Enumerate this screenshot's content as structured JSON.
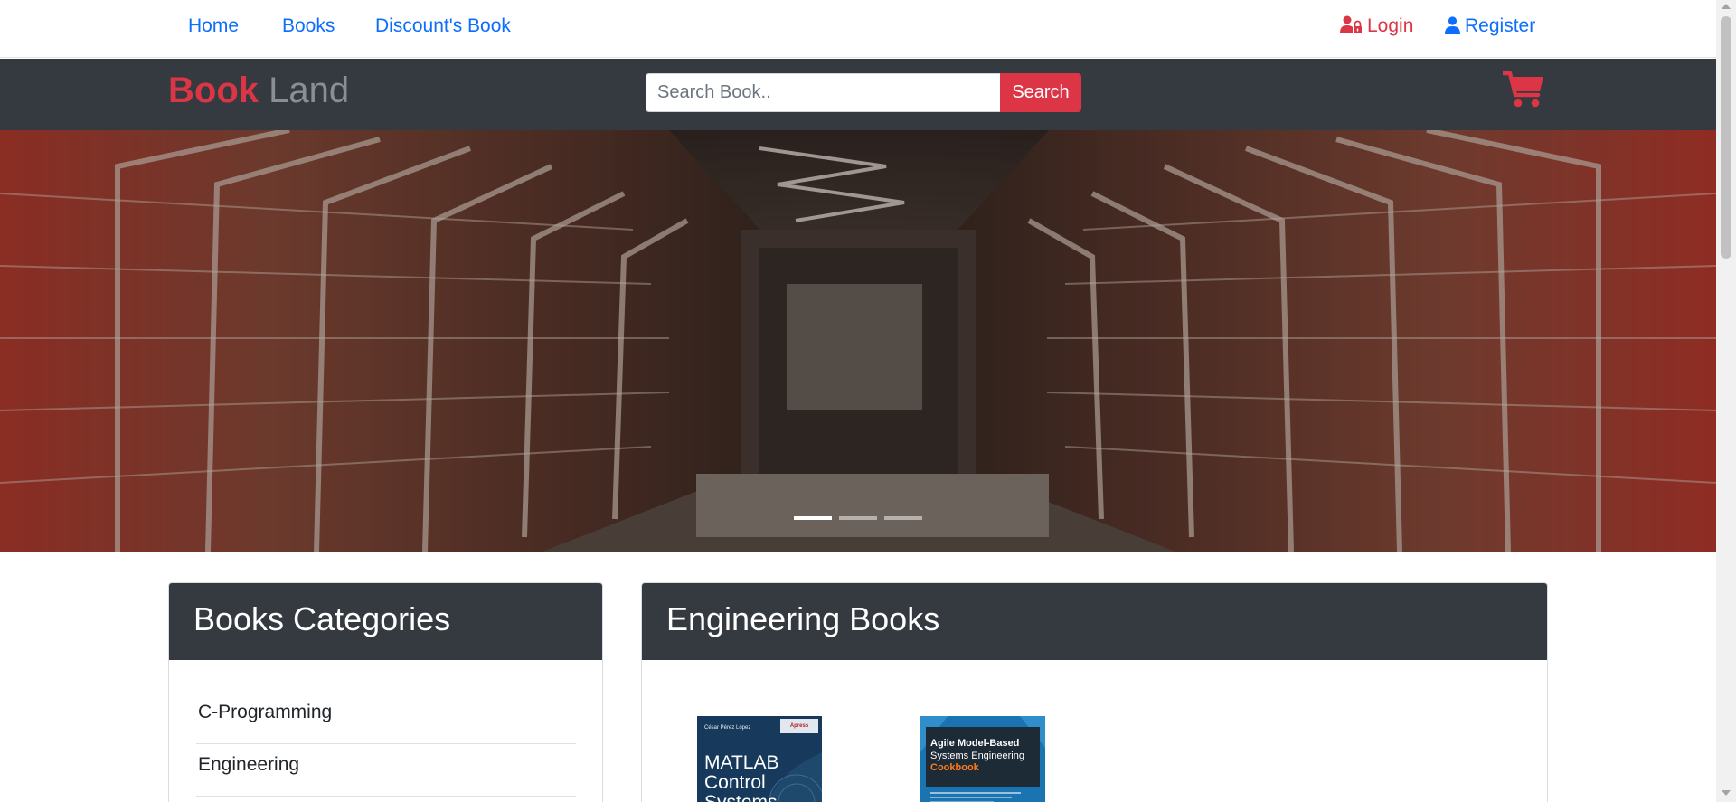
{
  "nav": {
    "home": "Home",
    "books": "Books",
    "discount": "Discount's Book",
    "login": "Login",
    "register": "Register"
  },
  "brand": {
    "part1": "Book",
    "part2": "Land"
  },
  "search": {
    "placeholder": "Search Book..",
    "value": "",
    "button": "Search"
  },
  "icons": {
    "login": "user-lock-icon",
    "register": "user-icon",
    "cart": "shopping-cart-icon"
  },
  "colors": {
    "accent": "#dc3545",
    "link": "#0d6efd",
    "dark": "#343a40",
    "brand_muted": "#8a8f94"
  },
  "carousel": {
    "slide_count": 3,
    "active_index": 0
  },
  "categories": {
    "title": "Books Categories",
    "items": [
      "C-Programming",
      "Engineering"
    ]
  },
  "engineering": {
    "title": "Engineering Books",
    "books": [
      {
        "author": "César Pérez López",
        "publisher": "Apress",
        "title_lines": [
          "MATLAB",
          "Control",
          "Systems"
        ]
      },
      {
        "title_lines": [
          "Agile Model-Based",
          "Systems Engineering"
        ],
        "subtitle": "Cookbook"
      }
    ]
  }
}
